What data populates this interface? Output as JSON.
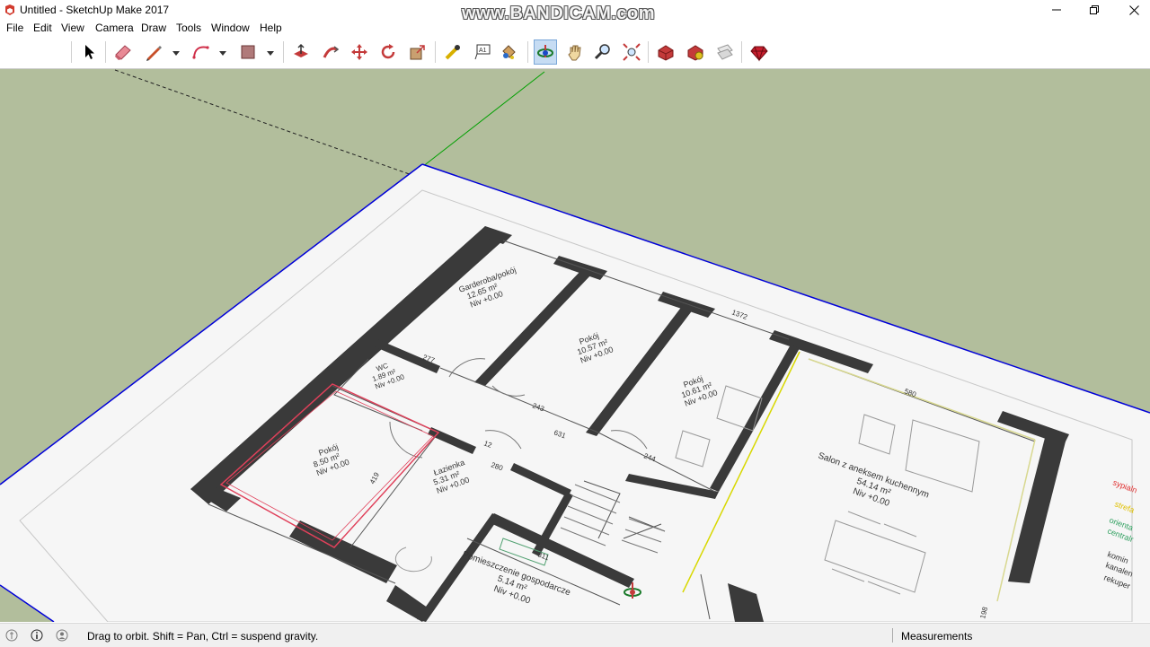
{
  "window": {
    "title": "Untitled - SketchUp Make 2017",
    "watermark": "www.BANDICAM.com"
  },
  "menu": [
    "File",
    "Edit",
    "View",
    "Camera",
    "Draw",
    "Tools",
    "Window",
    "Help"
  ],
  "toolbar": {
    "tools": [
      "select-tool",
      "eraser-tool",
      "pencil-tool",
      "arc-tool",
      "rectangle-tool",
      "push-pull-tool",
      "follow-me-tool",
      "move-tool",
      "rotate-tool",
      "scale-tool",
      "tape-measure-tool",
      "text-tool",
      "paint-bucket-tool",
      "orbit-tool",
      "pan-tool",
      "zoom-tool",
      "zoom-extents-tool",
      "3d-warehouse-tool",
      "extension-warehouse-tool",
      "layout-tool",
      "ruby-tool"
    ],
    "active": "orbit-tool"
  },
  "plan": {
    "rooms": [
      {
        "name": "Garderoba/pokój",
        "area": "12.65 m²",
        "level": "Niv +0.00"
      },
      {
        "name": "Pokój",
        "area": "10.57 m²",
        "level": "Niv +0.00"
      },
      {
        "name": "Pokój",
        "area": "10.61 m²",
        "level": "Niv +0.00"
      },
      {
        "name": "WC",
        "area": "1.89 m²",
        "level": "Niv +0.00"
      },
      {
        "name": "Pokój",
        "area": "8.50 m²",
        "level": "Niv +0.00"
      },
      {
        "name": "Łazienka",
        "area": "5.31 m²",
        "level": "Niv +0.00"
      },
      {
        "name": "Salon z aneksem kuchennym",
        "area": "54.14 m²",
        "level": "Niv +0.00"
      },
      {
        "name": "Pomieszczenie gospodarcze",
        "area": "5.14 m²",
        "level": "Niv +0.00"
      }
    ],
    "dimensions": [
      "1372",
      "277",
      "243",
      "631",
      "244",
      "280",
      "12",
      "580",
      "311",
      "419",
      "198"
    ],
    "legend": [
      "sypialn",
      "strefa",
      "orienta",
      "centralr",
      "komin",
      "kanalen",
      "rekuper"
    ]
  },
  "status": {
    "hint": "Drag to orbit. Shift = Pan, Ctrl = suspend gravity.",
    "measurements_label": "Measurements",
    "measurements_value": ""
  },
  "colors": {
    "sky": "#b2be9c",
    "paper": "#f6f6f6",
    "wall": "#3a3a3a",
    "axis_blue": "#0000d8",
    "axis_green": "#00a000",
    "selection": "#e0405a"
  }
}
